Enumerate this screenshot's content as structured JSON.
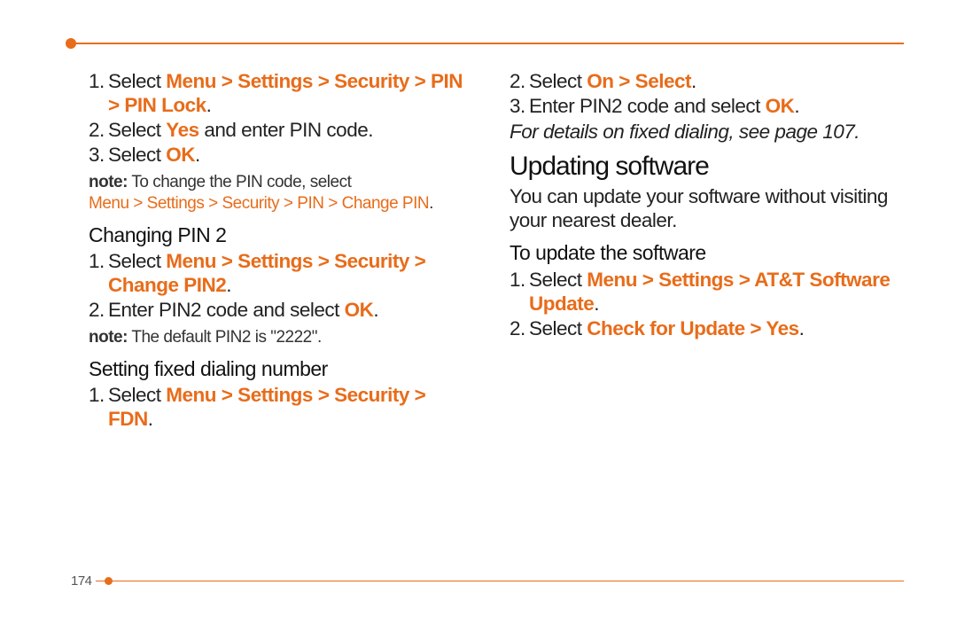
{
  "page_number": "174",
  "left": {
    "steps_a": {
      "s1_pre": "Select ",
      "s1_path": "Menu > Settings > Security > PIN > PIN Lock",
      "s2_pre": "Select ",
      "s2_bold": "Yes",
      "s2_post": " and enter PIN code.",
      "s3_pre": "Select ",
      "s3_bold": "OK"
    },
    "note1_label": "note:",
    "note1_text": " To change the PIN code, select ",
    "note1_path": "Menu > Settings > Security > PIN > Change PIN",
    "h_changing_pin2": "Changing PIN 2",
    "steps_b": {
      "s1_pre": "Select ",
      "s1_path": "Menu > Settings > Security > Change PIN2",
      "s2_pre": "Enter PIN2 code and select ",
      "s2_bold": "OK"
    },
    "note2_label": "note:",
    "note2_text": " The default PIN2 is \"2222\".",
    "h_fdn": "Setting fixed dialing number",
    "steps_c": {
      "s1_pre": "Select ",
      "s1_path": "Menu > Settings > Security > FDN"
    }
  },
  "right": {
    "steps_d": {
      "s2_pre": "Select ",
      "s2_path": "On > Select",
      "s3_pre": "Enter PIN2 code and select ",
      "s3_bold": "OK"
    },
    "fdn_ref": "For details on fixed dialing, see page 107.",
    "h_updating": "Updating software",
    "updating_para": "You can update your software without visiting your nearest dealer.",
    "h_to_update": "To update the software",
    "steps_e": {
      "s1_pre": "Select ",
      "s1_path": "Menu > Settings > AT&T Software Update",
      "s2_pre": "Select ",
      "s2_path": "Check for Update > Yes"
    }
  }
}
